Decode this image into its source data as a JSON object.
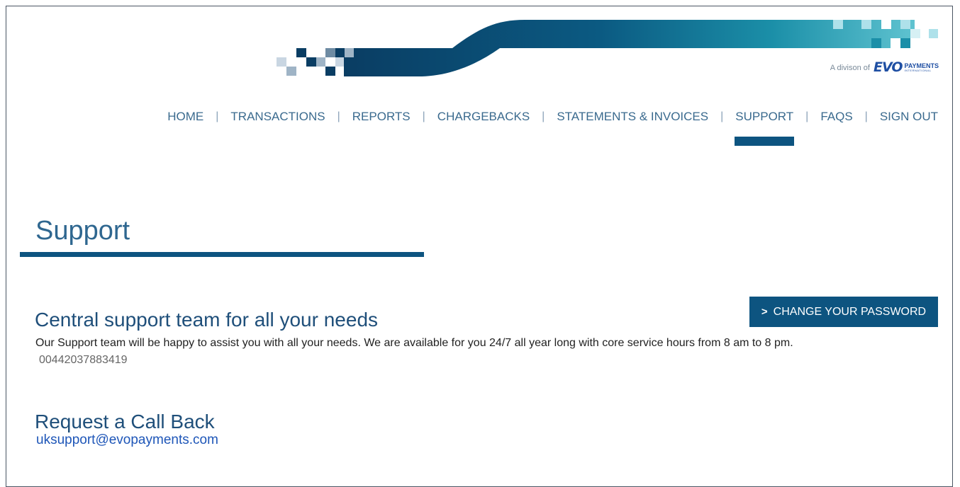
{
  "header": {
    "division_text": "A divison of",
    "logo_mark": "EVO",
    "logo_word": "PAYMENTS",
    "logo_subword": "INTERNATIONAL"
  },
  "nav": {
    "items": [
      {
        "label": "HOME"
      },
      {
        "label": "TRANSACTIONS"
      },
      {
        "label": "REPORTS"
      },
      {
        "label": "CHARGEBACKS"
      },
      {
        "label": "STATEMENTS & INVOICES"
      },
      {
        "label": "SUPPORT",
        "active": true
      },
      {
        "label": "FAQS"
      },
      {
        "label": "SIGN OUT"
      }
    ],
    "separator": "|"
  },
  "page": {
    "title": "Support",
    "change_password_icon": ">",
    "change_password_label": "CHANGE YOUR PASSWORD",
    "central_heading": "Central support team for all your needs",
    "central_description": "Our Support team will be happy to assist you with all your needs. We are available for you 24/7 all year long with core service hours from 8 am to 8 pm.",
    "phone": "00442037883419",
    "callback_heading": "Request a Call Back",
    "email": "uksupport@evopayments.com"
  },
  "colors": {
    "primary": "#0d5480",
    "nav_text": "#3a6a8e",
    "heading": "#1f4f7a",
    "link": "#1e56b8"
  }
}
